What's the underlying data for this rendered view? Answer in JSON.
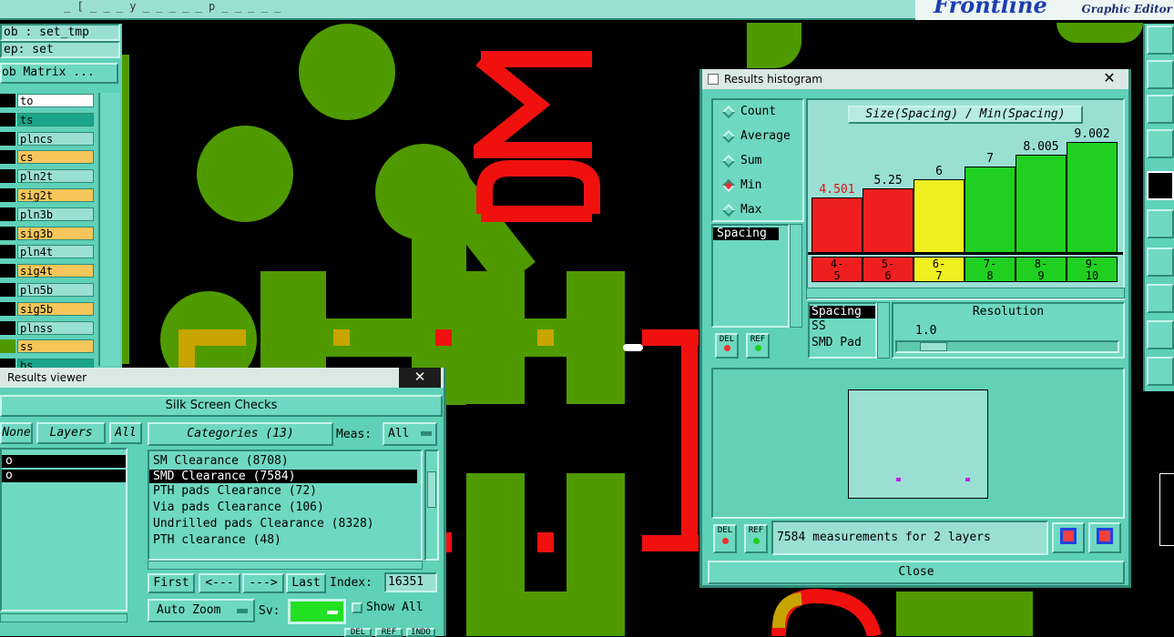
{
  "topbar": {
    "title_fragment": "_ [ _ _ _ y _ _ _ _ _ p _ _ _ _ _",
    "brand": "Frontline",
    "subtitle": "Graphic Editor"
  },
  "job_panel": {
    "job_line": "ob : set_tmp",
    "step_line": "ep: set",
    "matrix_button": "ob Matrix ..."
  },
  "layers": [
    {
      "name": "to",
      "sw": "#000000",
      "bg": "#ffffff"
    },
    {
      "name": "ts",
      "sw": "#000000",
      "bg": "#1aa58a"
    },
    {
      "name": "plncs",
      "sw": "#000000",
      "bg": "#9adfd4"
    },
    {
      "name": "cs",
      "sw": "#000000",
      "bg": "#f7c65a"
    },
    {
      "name": "pln2t",
      "sw": "#000000",
      "bg": "#9adfd4"
    },
    {
      "name": "sig2t",
      "sw": "#000000",
      "bg": "#f7c65a"
    },
    {
      "name": "pln3b",
      "sw": "#000000",
      "bg": "#9adfd4"
    },
    {
      "name": "sig3b",
      "sw": "#000000",
      "bg": "#f7c65a"
    },
    {
      "name": "pln4t",
      "sw": "#000000",
      "bg": "#9adfd4"
    },
    {
      "name": "sig4t",
      "sw": "#000000",
      "bg": "#f7c65a"
    },
    {
      "name": "pln5b",
      "sw": "#000000",
      "bg": "#9adfd4"
    },
    {
      "name": "sig5b",
      "sw": "#000000",
      "bg": "#f7c65a"
    },
    {
      "name": "plnss",
      "sw": "#000000",
      "bg": "#9adfd4"
    },
    {
      "name": "ss",
      "sw": "#4f9a00",
      "bg": "#f7c65a"
    },
    {
      "name": "bs",
      "sw": "#000000",
      "bg": "#1aa58a"
    }
  ],
  "results_viewer": {
    "window_title": "Results viewer",
    "close_glyph": "✕",
    "header": "Silk Screen Checks",
    "none_button": "None",
    "layers_button": "Layers",
    "all_button": "All",
    "layer_list": [
      "o",
      "o"
    ],
    "categories_button": "Categories (13)",
    "meas_label": "Meas:",
    "meas_value": "All",
    "categories": [
      "SM Clearance (8708)",
      "SMD Clearance (7584)",
      "PTH pads Clearance (72)",
      "Via pads Clearance (106)",
      "Undrilled pads Clearance (8328)",
      "PTH clearance (48)"
    ],
    "selected_category": 1,
    "first_button": "First",
    "prev_button": "<---",
    "next_button": "--->",
    "last_button": "Last",
    "index_label": "Index:",
    "index_value": "16351",
    "zoom_button": "Auto Zoom",
    "sv_label": "Sv:",
    "show_all_label": "Show All",
    "bottom_buttons": [
      "DEL",
      "REF",
      "INDO"
    ]
  },
  "histogram": {
    "window_title": "Results histogram",
    "close_glyph": "✕",
    "modes": [
      "Count",
      "Average",
      "Sum",
      "Min",
      "Max"
    ],
    "selected_mode": "Min",
    "left_list": [
      "Spacing"
    ],
    "del_label": "DEL",
    "ref_label": "REF",
    "measure_list": [
      "Spacing",
      "SS",
      "SMD Pad"
    ],
    "resolution_label": "Resolution",
    "resolution_value": "1.0",
    "resolution_fraction": 0.12,
    "status": "7584 measurements for 2 layers",
    "close_button": "Close"
  },
  "chart_data": {
    "type": "bar",
    "title": "Size(Spacing) / Min(Spacing)",
    "categories": [
      "4-5",
      "5-6",
      "6-7",
      "7-8",
      "8-9",
      "9-10"
    ],
    "range_labels": [
      [
        "4-",
        "5"
      ],
      [
        "5-",
        "6"
      ],
      [
        "6-",
        "7"
      ],
      [
        "7-",
        "8"
      ],
      [
        "8-",
        "9"
      ],
      [
        "9-",
        "10"
      ]
    ],
    "values": [
      4.501,
      5.25,
      6,
      7,
      8.005,
      9.002
    ],
    "value_labels": [
      "4.501",
      "5.25",
      "6",
      "7",
      "8.005",
      "9.002"
    ],
    "colors": [
      "#f01f1f",
      "#f01f1f",
      "#f0f020",
      "#20d020",
      "#20d020",
      "#20d020"
    ],
    "ylim": [
      0,
      9.9
    ]
  }
}
